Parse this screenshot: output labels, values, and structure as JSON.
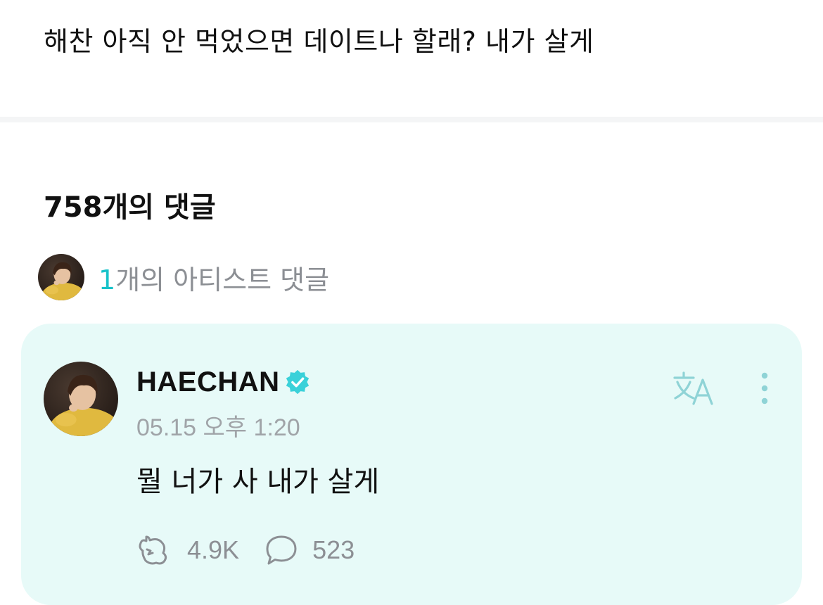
{
  "post": {
    "text": "해찬 아직 안 먹었으면 데이트나 할래? 내가 살게"
  },
  "comments_section": {
    "count_label": "758개의 댓글",
    "artist_summary": {
      "count": "1",
      "label": "개의 아티스트 댓글"
    }
  },
  "artist_comment": {
    "author": "HAECHAN",
    "verified": true,
    "timestamp": "05.15 오후 1:20",
    "body": "뭘 너가 사 내가 살게",
    "reactions": {
      "likes": "4.9K",
      "replies": "523"
    },
    "icons": {
      "translate": "translate-icon",
      "more": "more-vertical-icon",
      "like": "reaction-icon",
      "reply": "speech-bubble-icon",
      "verified": "verified-badge-icon"
    }
  },
  "colors": {
    "accent": "#17c2c9",
    "card_background": "#e7faf8",
    "muted_text": "#8c8f94",
    "verified_badge": "#3ad1d9"
  }
}
